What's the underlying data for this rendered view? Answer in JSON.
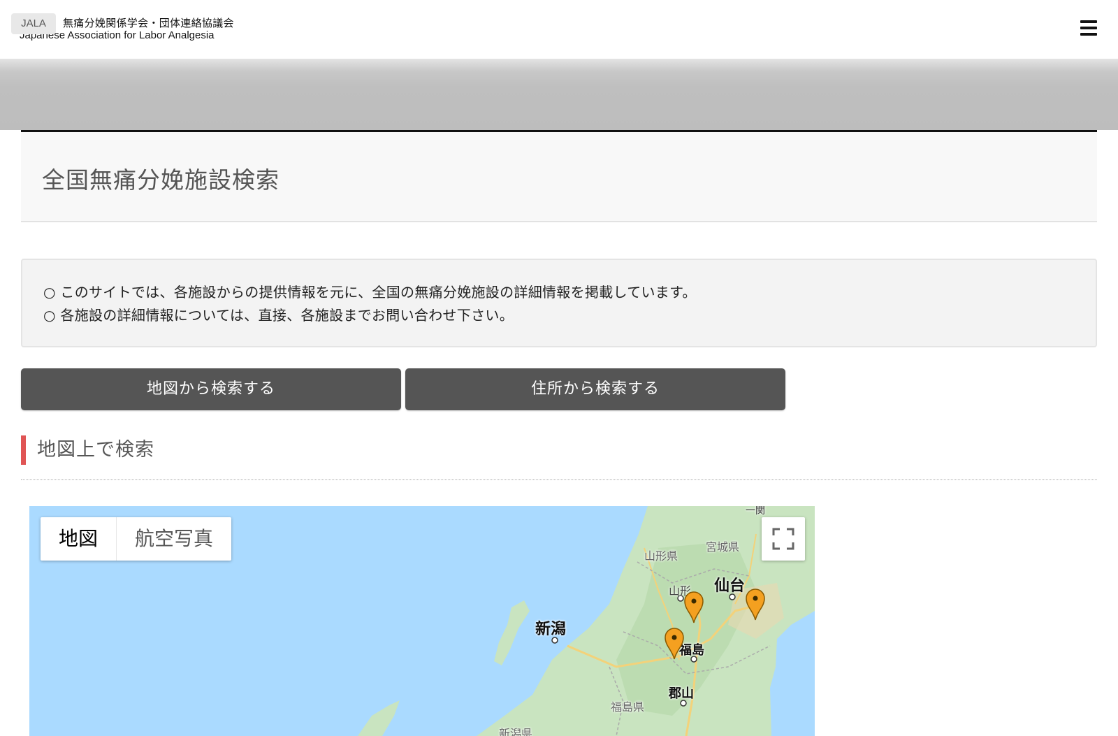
{
  "header": {
    "logo_badge": "JALA",
    "logo_jp": "無痛分娩関係学会・団体連絡協議会",
    "logo_en": "Japanese Association for Labor Analgesia",
    "menu_icon": "hamburger-menu-icon"
  },
  "page": {
    "title": "全国無痛分娩施設検索"
  },
  "notice": {
    "items": [
      "○ このサイトでは、各施設からの提供情報を元に、全国の無痛分娩施設の詳細情報を掲載しています。",
      "○ 各施設の詳細情報については、直接、各施設までお問い合わせ下さい。"
    ]
  },
  "buttons": {
    "map_search": "地図から検索する",
    "address_search": "住所から検索する"
  },
  "section": {
    "heading": "地図上で検索"
  },
  "map": {
    "type_map": "地図",
    "type_satellite": "航空写真",
    "fullscreen_icon": "fullscreen-icon",
    "pin_icon": "map-pin-icon",
    "pin_color": "#f4a020",
    "labels": {
      "niigata": "新潟",
      "sendai": "仙台",
      "fukushima": "福島",
      "koriyama": "郡山",
      "yamagata": "山形",
      "yamagata_pref": "山形県",
      "miyagi_pref": "宮城県",
      "fukushima_pref": "福島県",
      "niigata_pref": "新潟県",
      "ichinoseki": "一関"
    }
  }
}
